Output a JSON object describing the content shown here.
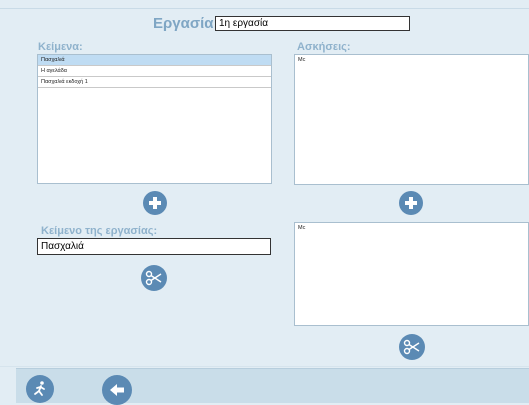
{
  "header": {
    "task_label": "Εργασία:",
    "task_value": "1η εργασία"
  },
  "texts_panel": {
    "label": "Κείμενα:",
    "items": [
      "Πασχαλιά",
      "Η αγελάδα",
      "Πασχαλιά εκδοχή 1"
    ],
    "selected_index": 0
  },
  "exercises_panel": {
    "label": "Ασκήσεις:",
    "items": [
      "Mc"
    ]
  },
  "task_text": {
    "label": "Κείμενο της εργασίας:",
    "value": "Πασχαλιά"
  },
  "task_exercises": {
    "items": [
      "Mc"
    ]
  },
  "icons": {
    "add": "plus-icon",
    "cut": "scissors-icon",
    "exit": "running-man-icon",
    "back": "arrow-left-icon"
  },
  "colors": {
    "accent": "#5b8ab4",
    "label": "#8fb2cc",
    "background": "#e2edf4",
    "selected_row": "#bfdcf3"
  }
}
